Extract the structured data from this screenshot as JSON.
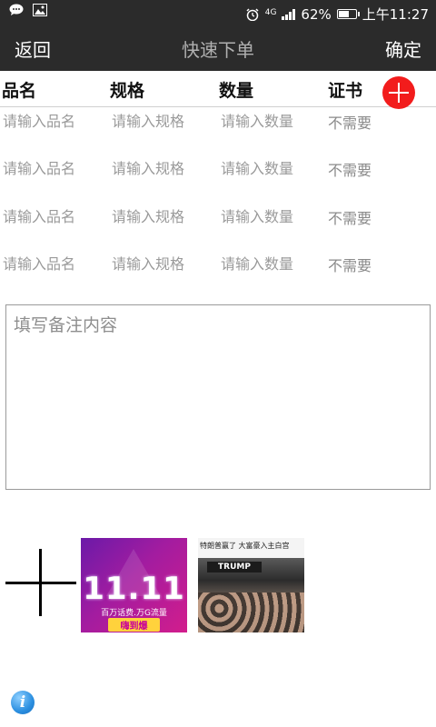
{
  "status_bar": {
    "network": "4G",
    "battery": "62%",
    "battery_level": 0.62,
    "time": "上午11:27"
  },
  "nav": {
    "back": "返回",
    "title": "快速下单",
    "confirm": "确定"
  },
  "columns": [
    "品名",
    "规格",
    "数量",
    "证书"
  ],
  "rows": [
    {
      "name_placeholder": "请输入品名",
      "spec_placeholder": "请输入规格",
      "qty_placeholder": "请输入数量",
      "cert": "不需要"
    },
    {
      "name_placeholder": "请输入品名",
      "spec_placeholder": "请输入规格",
      "qty_placeholder": "请输入数量",
      "cert": "不需要"
    },
    {
      "name_placeholder": "请输入品名",
      "spec_placeholder": "请输入规格",
      "qty_placeholder": "请输入数量",
      "cert": "不需要"
    },
    {
      "name_placeholder": "请输入品名",
      "spec_placeholder": "请输入规格",
      "qty_placeholder": "请输入数量",
      "cert": "不需要"
    }
  ],
  "remark": {
    "placeholder": "填写备注内容"
  },
  "images": [
    {
      "big_text": "11.11",
      "line1": "百万话费.万G流量",
      "line2": "嗨到爆"
    },
    {
      "caption": "特朗普赢了 大富豪入主白宫",
      "sign": "TRUMP"
    }
  ],
  "icons": {
    "add_row": "plus-circle-icon",
    "add_photo": "plus-icon",
    "info": "info-icon"
  },
  "colors": {
    "nav_bg": "#2b2b2b",
    "add_button": "#f21c1c",
    "info_button": "#2b8fe0"
  }
}
